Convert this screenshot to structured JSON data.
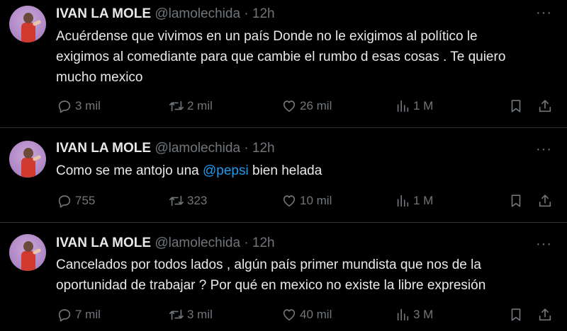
{
  "colors": {
    "background": "#000000",
    "text": "#e7e9ea",
    "muted": "#71767b",
    "link": "#1d9bf0",
    "divider": "#2f3336"
  },
  "tweets": [
    {
      "name": "IVAN LA MOLE",
      "handle": "@lamolechida",
      "sep": "·",
      "time": "12h",
      "text_lines": [
        "Acuérdense que vivimos en un país Donde no le exigimos al político le",
        "exigimos al comediante para que cambie el rumbo d esas cosas . Te quiero",
        "mucho mexico"
      ],
      "replies": "3 mil",
      "retweets": "2 mil",
      "likes": "26 mil",
      "views": "1 M"
    },
    {
      "name": "IVAN LA MOLE",
      "handle": "@lamolechida",
      "sep": "·",
      "time": "12h",
      "text_before": "Como se me antojo una ",
      "mention": "@pepsi",
      "text_after": " bien helada",
      "replies": "755",
      "retweets": "323",
      "likes": "10 mil",
      "views": "1 M"
    },
    {
      "name": "IVAN LA MOLE",
      "handle": "@lamolechida",
      "sep": "·",
      "time": "12h",
      "text_lines": [
        "Cancelados por todos lados , algún país primer mundista que nos de la",
        "oportunidad de trabajar ? Por qué en mexico no existe la libre expresión"
      ],
      "replies": "7 mil",
      "retweets": "3 mil",
      "likes": "40 mil",
      "views": "3 M"
    }
  ],
  "icons": {
    "more": "more-horizontal-icon",
    "reply": "reply-bubble-icon",
    "retweet": "retweet-icon",
    "like": "heart-icon",
    "views": "views-bar-chart-icon",
    "bookmark": "bookmark-icon",
    "share": "share-icon"
  }
}
